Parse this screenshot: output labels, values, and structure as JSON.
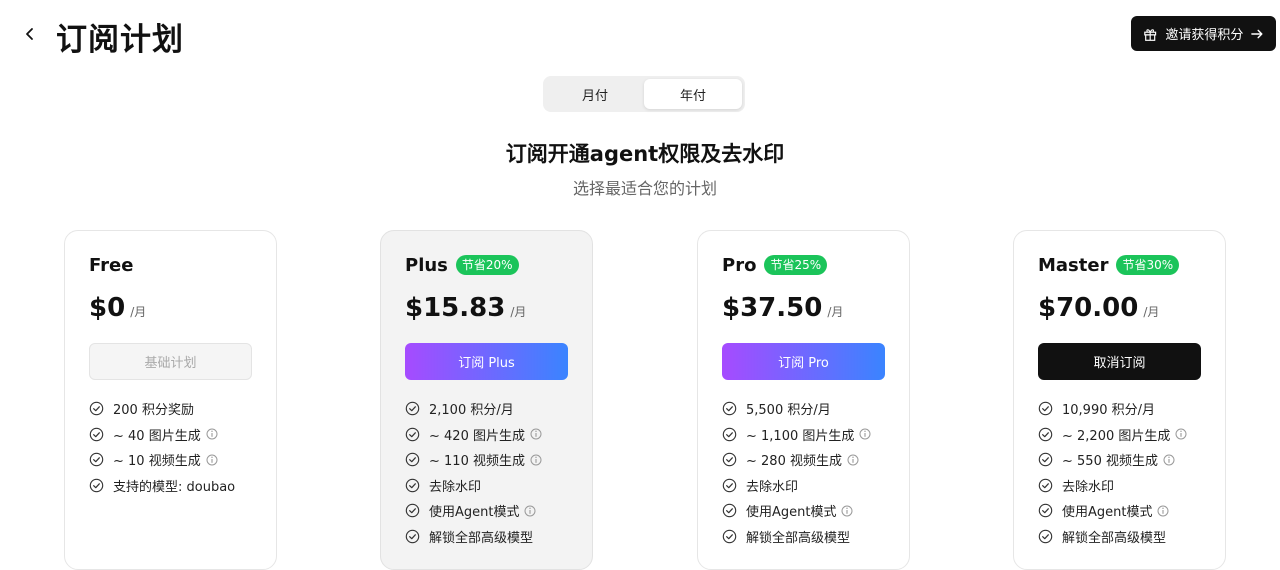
{
  "header": {
    "title": "订阅计划",
    "invite_label": "邀请获得积分"
  },
  "billing_toggle": {
    "options": [
      "月付",
      "年付"
    ],
    "selected": "年付"
  },
  "hero": {
    "headline": "订阅开通agent权限及去水印",
    "subheadline": "选择最适合您的计划"
  },
  "colors": {
    "badge_green": "#1bc45a",
    "gradient_start": "#a64bff",
    "gradient_end": "#3a84ff",
    "dark": "#111111"
  },
  "plans": [
    {
      "name": "Free",
      "badge": "",
      "price": "$0",
      "per": "/月",
      "cta": "基础计划",
      "cta_style": "disabled",
      "features": [
        {
          "text": "200 积分奖励",
          "info": false
        },
        {
          "text": "~ 40 图片生成",
          "info": true
        },
        {
          "text": "~ 10 视频生成",
          "info": true
        },
        {
          "text": "支持的模型: doubao",
          "info": false
        }
      ]
    },
    {
      "name": "Plus",
      "badge": "节省20%",
      "price": "$15.83",
      "per": "/月",
      "cta": "订阅 Plus",
      "cta_style": "gradient",
      "features": [
        {
          "text": "2,100 积分/月",
          "info": false
        },
        {
          "text": "~ 420 图片生成",
          "info": true
        },
        {
          "text": "~ 110 视频生成",
          "info": true
        },
        {
          "text": "去除水印",
          "info": false
        },
        {
          "text": "使用Agent模式",
          "info": true
        },
        {
          "text": "解锁全部高级模型",
          "info": false
        }
      ]
    },
    {
      "name": "Pro",
      "badge": "节省25%",
      "price": "$37.50",
      "per": "/月",
      "cta": "订阅 Pro",
      "cta_style": "gradient",
      "features": [
        {
          "text": "5,500 积分/月",
          "info": false
        },
        {
          "text": "~ 1,100 图片生成",
          "info": true
        },
        {
          "text": "~ 280 视频生成",
          "info": true
        },
        {
          "text": "去除水印",
          "info": false
        },
        {
          "text": "使用Agent模式",
          "info": true
        },
        {
          "text": "解锁全部高级模型",
          "info": false
        }
      ]
    },
    {
      "name": "Master",
      "badge": "节省30%",
      "price": "$70.00",
      "per": "/月",
      "cta": "取消订阅",
      "cta_style": "dark",
      "features": [
        {
          "text": "10,990 积分/月",
          "info": false
        },
        {
          "text": "~ 2,200 图片生成",
          "info": true
        },
        {
          "text": "~ 550 视频生成",
          "info": true
        },
        {
          "text": "去除水印",
          "info": false
        },
        {
          "text": "使用Agent模式",
          "info": true
        },
        {
          "text": "解锁全部高级模型",
          "info": false
        }
      ]
    }
  ]
}
